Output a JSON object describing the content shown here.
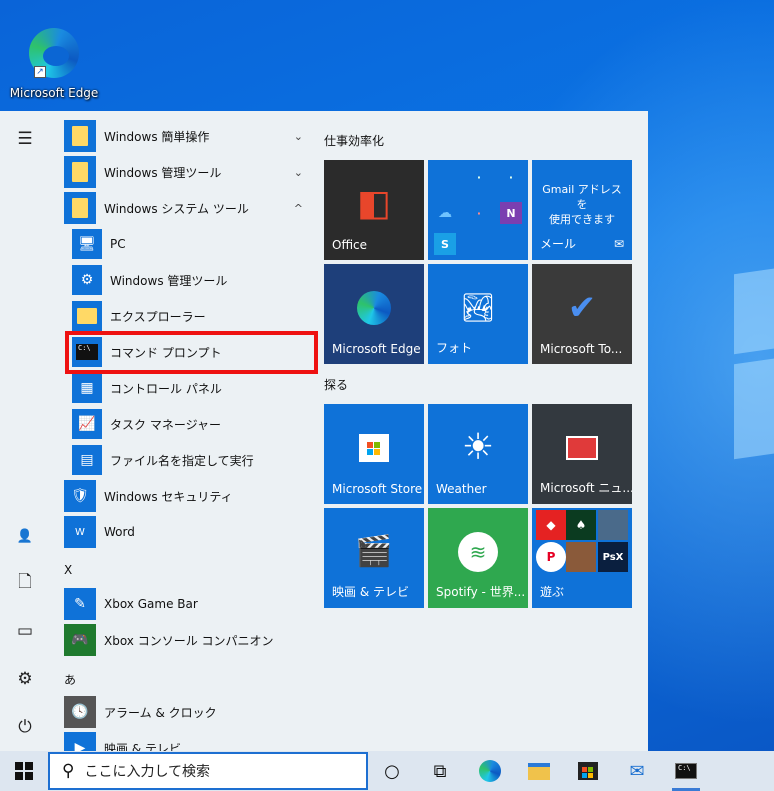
{
  "desktop": {
    "edge_label": "Microsoft Edge"
  },
  "rail": {
    "icons": [
      "hamburger-icon",
      "user-icon",
      "document-icon",
      "pictures-icon",
      "settings-icon",
      "power-icon"
    ]
  },
  "applist": {
    "items": [
      {
        "label": "Windows 簡単操作",
        "chevron": "⌄"
      },
      {
        "label": "Windows 管理ツール",
        "chevron": "⌄"
      },
      {
        "label": "Windows システム ツール",
        "chevron": "^"
      },
      {
        "label": "PC"
      },
      {
        "label": "Windows 管理ツール"
      },
      {
        "label": "エクスプローラー"
      },
      {
        "label": "コマンド プロンプト"
      },
      {
        "label": "コントロール パネル"
      },
      {
        "label": "タスク マネージャー"
      },
      {
        "label": "ファイル名を指定して実行"
      },
      {
        "label": "Windows セキュリティ"
      },
      {
        "label": "Word"
      },
      {
        "label": "Xbox Game Bar"
      },
      {
        "label": "Xbox コンソール コンパニオン"
      },
      {
        "label": "アラーム & クロック"
      },
      {
        "label": "映画 & テレビ"
      }
    ],
    "letters": [
      "X",
      "あ"
    ]
  },
  "tiles": {
    "group1_title": "仕事効率化",
    "group2_title": "探る",
    "office": "Office",
    "gmail_line1": "Gmail アドレスを",
    "gmail_line2": "使用できます",
    "mail": "メール",
    "edge": "Microsoft Edge",
    "photos": "フォト",
    "todo": "Microsoft To...",
    "store": "Microsoft Store",
    "weather": "Weather",
    "news": "Microsoft ニュ...",
    "movies": "映画 & テレビ",
    "spotify": "Spotify - 世界...",
    "play": "遊ぶ"
  },
  "taskbar": {
    "search_placeholder": "ここに入力して検索"
  }
}
